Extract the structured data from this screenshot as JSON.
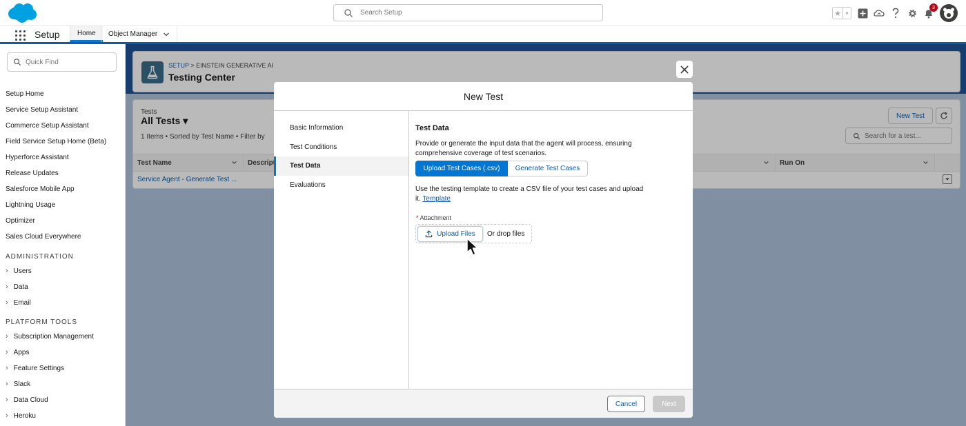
{
  "header": {
    "search_placeholder": "Search Setup",
    "notification_count": "3"
  },
  "context_bar": {
    "app_name": "Setup",
    "tabs": [
      {
        "label": "Home"
      },
      {
        "label": "Object Manager"
      }
    ]
  },
  "sidebar": {
    "quick_find_placeholder": "Quick Find",
    "items": [
      "Setup Home",
      "Service Setup Assistant",
      "Commerce Setup Assistant",
      "Field Service Setup Home (Beta)",
      "Hyperforce Assistant",
      "Release Updates",
      "Salesforce Mobile App",
      "Lightning Usage",
      "Optimizer",
      "Sales Cloud Everywhere"
    ],
    "admin_heading": "ADMINISTRATION",
    "admin_items": [
      "Users",
      "Data",
      "Email"
    ],
    "platform_heading": "PLATFORM TOOLS",
    "platform_items": [
      "Subscription Management",
      "Apps",
      "Feature Settings",
      "Slack",
      "Data Cloud",
      "Heroku"
    ]
  },
  "page_header": {
    "breadcrumb_link": "SETUP",
    "breadcrumb_rest": " > EINSTEIN GENERATIVE AI",
    "title": "Testing Center"
  },
  "list_view": {
    "object_label": "Tests",
    "name": "All Tests ▾",
    "meta": "1 Items • Sorted by Test Name • Filter by",
    "new_button": "New Test",
    "search_placeholder": "Search for a test...",
    "columns": [
      "Test Name",
      "Descript",
      "Run On"
    ],
    "rows": [
      {
        "name": "Service Agent - Generate Test ..."
      }
    ]
  },
  "modal": {
    "title": "New Test",
    "steps": [
      "Basic Information",
      "Test Conditions",
      "Test Data",
      "Evaluations"
    ],
    "active_step": "Test Data",
    "section_title": "Test Data",
    "description": "Provide or generate the input data that the agent will process, ensuring comprehensive coverage of test scenarios.",
    "segment_primary": "Upload Test Cases (.csv)",
    "segment_secondary": "Generate Test Cases",
    "help_text": "Use the testing template to create a CSV file of your test cases and upload it. ",
    "help_link": "Template",
    "attachment_required": "*",
    "attachment_label": "Attachment",
    "upload_button": "Upload Files",
    "drop_text": "Or drop files",
    "cancel_button": "Cancel",
    "next_button": "Next"
  },
  "colors": {
    "brand": "#0176d3",
    "link": "#0b5cab",
    "header_band": "#1b5297"
  }
}
